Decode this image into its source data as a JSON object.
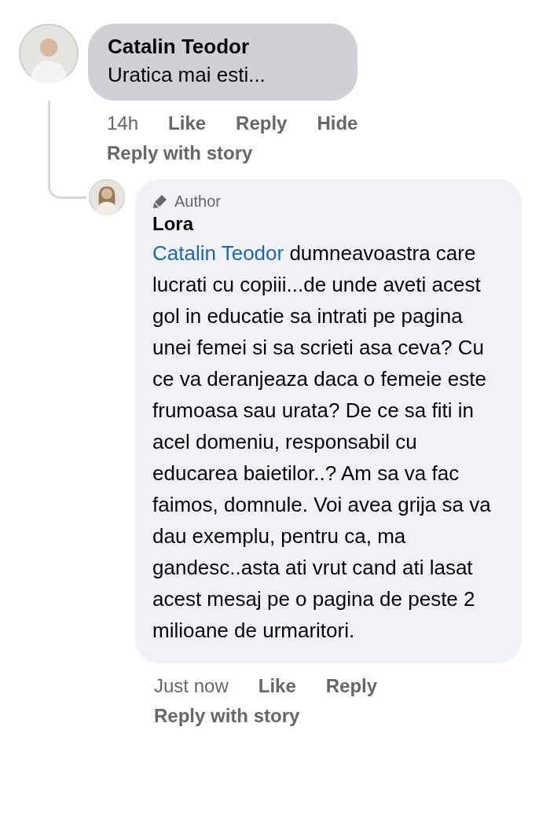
{
  "comment": {
    "author": "Catalin Teodor",
    "text": "Uratica mai esti...",
    "actions": [
      "14h",
      "Like",
      "Reply",
      "Hide"
    ],
    "story_action": "Reply with story"
  },
  "reply": {
    "badge": "Author",
    "author": "Lora",
    "mention": "Catalin Teodor",
    "text": " dumneavoastra care lucrati cu copiii...de unde aveti acest gol in educatie sa intrati pe pagina unei femei si sa scrieti asa ceva? Cu ce va deranjeaza daca o femeie este frumoasa sau urata? De ce sa fiti in acel domeniu, responsabil cu educarea baietilor..? Am sa va fac faimos, domnule. Voi avea grija sa va dau exemplu, pentru ca, ma gandesc..asta ati vrut cand ati lasat acest mesaj pe o pagina de peste 2 milioane de urmaritori.",
    "actions": [
      "Just now",
      "Like",
      "Reply"
    ],
    "story_action": "Reply with story"
  }
}
